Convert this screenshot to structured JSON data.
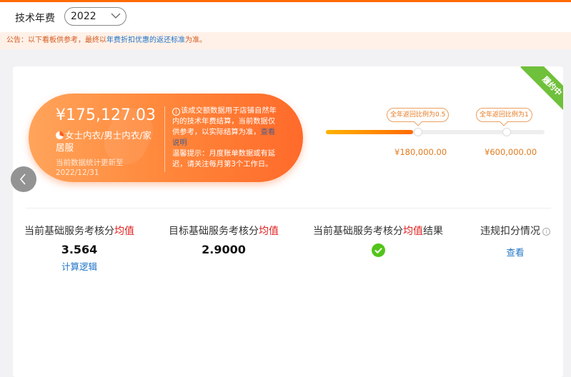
{
  "header": {
    "title": "技术年费",
    "year_select": {
      "value": "2022"
    }
  },
  "notice": {
    "prefix": "公告：以下看板供参考，最终以",
    "link": "年费折扣优惠的返还标准",
    "suffix": "为准。"
  },
  "status_ribbon": "履约中",
  "summary": {
    "amount": "¥175,127.03",
    "category": "女士内衣/男士内衣/家居服",
    "update_note": "当前数据统计更新至2022/12/31",
    "info_icon": "i",
    "info_text": "该成交额数据用于店铺自然年内的技术年费结算，当前数据仅供参考，以实际结算为准，",
    "info_link": "查看说明",
    "reminder": "温馨提示：月度账单数据或有延迟，请关注每月第3个工作日。"
  },
  "progress": {
    "fill_fraction": 0.4,
    "milestones": [
      {
        "tip": "全年返回比例为0.5",
        "value": "¥180,000.00"
      },
      {
        "tip": "全年返回比例为1",
        "value": "¥600,000.00"
      }
    ]
  },
  "metrics": [
    {
      "label_prefix": "当前基础服务考核分",
      "label_red": "均值",
      "label_suffix": "",
      "value": "3.564",
      "link": "计算逻辑"
    },
    {
      "label_prefix": "目标基础服务考核分",
      "label_red": "均值",
      "label_suffix": "",
      "value": "2.9000"
    },
    {
      "label_prefix": "当前基础服务考核分",
      "label_red": "均值",
      "label_suffix": "结果",
      "result_icon": "check-circle-icon"
    },
    {
      "label_prefix": "违规扣分情况",
      "help_icon": "i",
      "link": "查看"
    }
  ],
  "colors": {
    "accent": "#ff6a00",
    "success": "#52c41a",
    "ribbon": "#6fc03a",
    "link": "#1e73c7",
    "highlight_red": "#e0201f"
  }
}
